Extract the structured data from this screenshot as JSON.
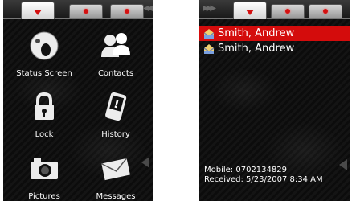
{
  "left_screen": {
    "menu": [
      {
        "label": "Status Screen",
        "icon": "dial-icon"
      },
      {
        "label": "Contacts",
        "icon": "people-icon"
      },
      {
        "label": "Lock",
        "icon": "padlock-icon"
      },
      {
        "label": "History",
        "icon": "phone-history-icon"
      },
      {
        "label": "Pictures",
        "icon": "camera-icon"
      },
      {
        "label": "Messages",
        "icon": "envelope-icon"
      }
    ]
  },
  "right_screen": {
    "list": [
      {
        "name": "Smith, Andrew",
        "selected": true,
        "icon": "open-envelope-icon"
      },
      {
        "name": "Smith, Andrew",
        "selected": false,
        "icon": "open-envelope-icon"
      }
    ],
    "details": {
      "mobile": "Mobile: 0702134829",
      "received": "Received: 5/23/2007 8:34 AM"
    }
  },
  "colors": {
    "accent": "#d40c0c",
    "background": "#111111",
    "text": "#ffffff"
  }
}
